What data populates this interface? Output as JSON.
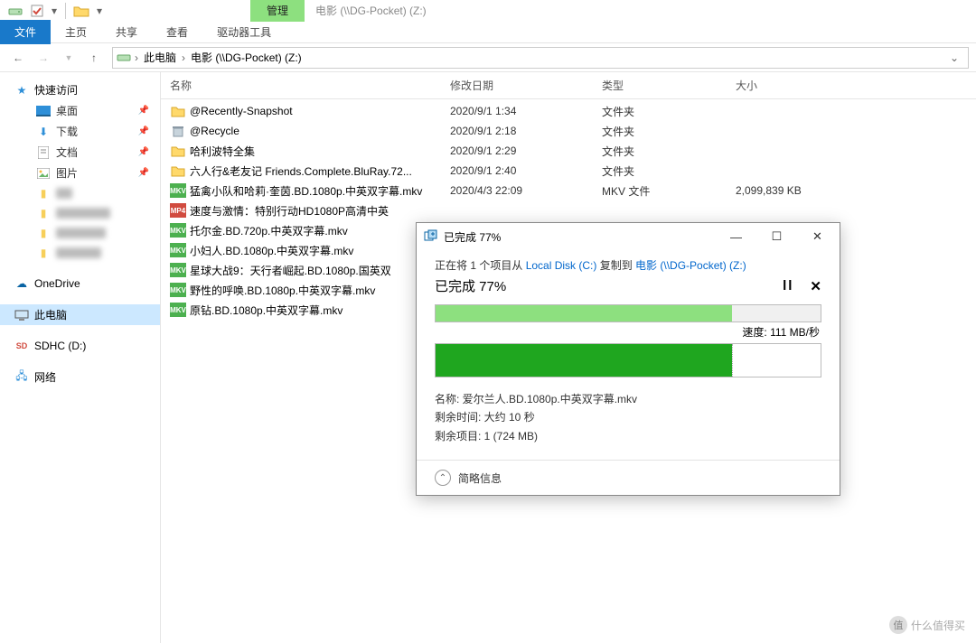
{
  "window": {
    "manage_tab": "管理",
    "title_path": "电影 (\\\\DG-Pocket) (Z:)"
  },
  "ribbon": {
    "file": "文件",
    "tabs": [
      "主页",
      "共享",
      "查看",
      "驱动器工具"
    ]
  },
  "breadcrumb": {
    "root": "此电脑",
    "path": "电影 (\\\\DG-Pocket) (Z:)"
  },
  "sidebar": {
    "quick_access": "快速访问",
    "desktop": "桌面",
    "downloads": "下载",
    "documents": "文档",
    "pictures": "图片",
    "onedrive": "OneDrive",
    "this_pc": "此电脑",
    "sdhc": "SDHC (D:)",
    "network": "网络"
  },
  "columns": {
    "name": "名称",
    "date": "修改日期",
    "type": "类型",
    "size": "大小"
  },
  "files": [
    {
      "icon": "folder",
      "name": "@Recently-Snapshot",
      "date": "2020/9/1 1:34",
      "type": "文件夹",
      "size": ""
    },
    {
      "icon": "folder-trash",
      "name": "@Recycle",
      "date": "2020/9/1 2:18",
      "type": "文件夹",
      "size": ""
    },
    {
      "icon": "folder",
      "name": "哈利波特全集",
      "date": "2020/9/1 2:29",
      "type": "文件夹",
      "size": ""
    },
    {
      "icon": "folder",
      "name": "六人行&老友记 Friends.Complete.BluRay.72...",
      "date": "2020/9/1 2:40",
      "type": "文件夹",
      "size": ""
    },
    {
      "icon": "mkv",
      "name": "猛禽小队和哈莉·奎茵.BD.1080p.中英双字幕.mkv",
      "date": "2020/4/3 22:09",
      "type": "MKV 文件",
      "size": "2,099,839 KB"
    },
    {
      "icon": "mp4",
      "name": "速度与激情：特别行动HD1080P高清中英",
      "date": "",
      "type": "",
      "size": ""
    },
    {
      "icon": "mkv",
      "name": "托尔金.BD.720p.中英双字幕.mkv",
      "date": "",
      "type": "",
      "size": ""
    },
    {
      "icon": "mkv",
      "name": "小妇人.BD.1080p.中英双字幕.mkv",
      "date": "",
      "type": "",
      "size": ""
    },
    {
      "icon": "mkv",
      "name": "星球大战9：天行者崛起.BD.1080p.国英双",
      "date": "",
      "type": "",
      "size": ""
    },
    {
      "icon": "mkv",
      "name": "野性的呼唤.BD.1080p.中英双字幕.mkv",
      "date": "",
      "type": "",
      "size": ""
    },
    {
      "icon": "mkv",
      "name": "原钻.BD.1080p.中英双字幕.mkv",
      "date": "",
      "type": "",
      "size": ""
    }
  ],
  "dialog": {
    "title": "已完成 77%",
    "copying_prefix": "正在将 1 个项目从 ",
    "source": "Local Disk (C:)",
    "copying_mid": " 复制到 ",
    "dest": "电影 (\\\\DG-Pocket) (Z:)",
    "progress_label": "已完成 77%",
    "percent": 77,
    "speed_label": "速度: ",
    "speed_value": "111 MB/秒",
    "name_label": "名称: ",
    "name_value": "爱尔兰人.BD.1080p.中英双字幕.mkv",
    "time_label": "剩余时间: ",
    "time_value": "大约 10 秒",
    "items_label": "剩余项目: ",
    "items_value": "1 (724 MB)",
    "less_info": "简略信息"
  },
  "watermark": "什么值得买"
}
